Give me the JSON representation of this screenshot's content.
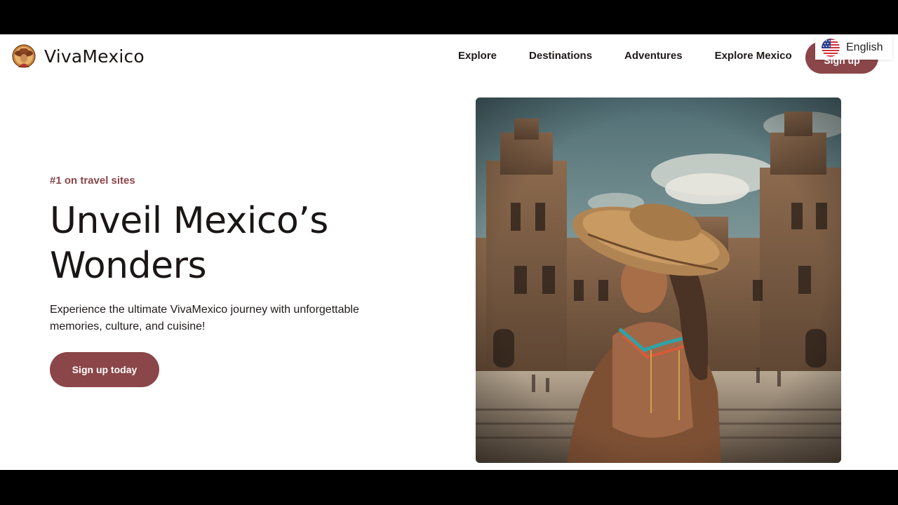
{
  "brand": {
    "name": "VivaMexico",
    "logo_icon": "mexican-woman-portrait-icon"
  },
  "nav": {
    "items": [
      {
        "label": "Explore"
      },
      {
        "label": "Destinations"
      },
      {
        "label": "Adventures"
      },
      {
        "label": "Explore Mexico"
      }
    ],
    "signup_label": "Sign up"
  },
  "language": {
    "label": "English",
    "flag_icon": "us-flag-icon"
  },
  "hero": {
    "eyebrow": "#1 on travel sites",
    "headline_line1": "Unveil Mexico’s",
    "headline_line2": "Wonders",
    "subtext": "Experience the ultimate VivaMexico journey with unforgettable memories, culture, and cuisine!",
    "cta_label": "Sign up today",
    "image_alt": "woman-in-sombrero-at-cathedral-photo"
  },
  "colors": {
    "accent": "#8b4649",
    "text": "#1b1616",
    "background": "#ffffff"
  }
}
